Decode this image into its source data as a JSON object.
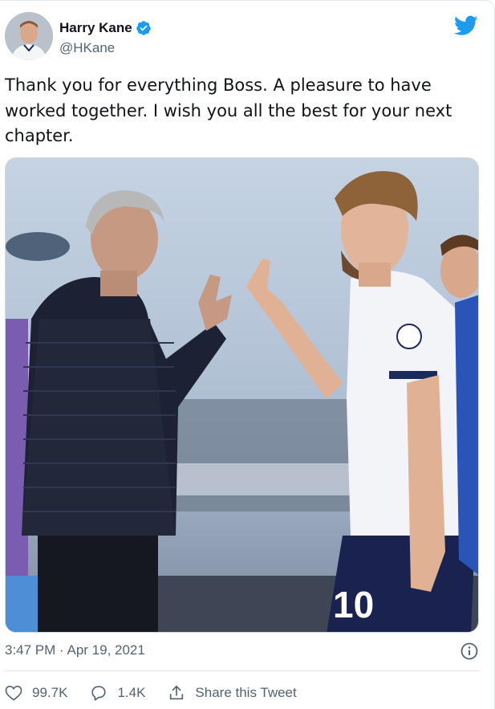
{
  "user": {
    "name": "Harry Kane",
    "handle": "@HKane"
  },
  "tweet": {
    "text": "Thank you for everything Boss. A pleasure to have worked together. I wish you all the best for your next chapter.",
    "timestamp": "3:47 PM · Apr 19, 2021"
  },
  "actions": {
    "likes": "99.7K",
    "replies": "1.4K",
    "share_label": "Share this Tweet"
  },
  "colors": {
    "brand": "#1d9bf0",
    "text_secondary": "#536471"
  },
  "icons": [
    "verified-badge-icon",
    "twitter-bird-icon",
    "info-icon",
    "heart-icon",
    "reply-icon",
    "share-icon"
  ],
  "media": {
    "shirt_number": "10"
  }
}
